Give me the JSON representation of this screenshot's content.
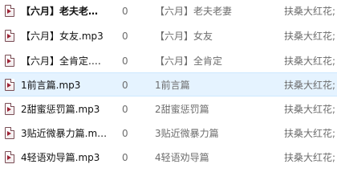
{
  "rows": [
    {
      "name": "【六月】老夫老妻....",
      "number": "0",
      "title": "【六月】老夫老妻",
      "artist": "扶桑大红花;"
    },
    {
      "name": "【六月】女友.mp3",
      "number": "0",
      "title": "【六月】女友",
      "artist": "扶桑大红花;"
    },
    {
      "name": "【六月】全肯定.mp3",
      "number": "0",
      "title": "【六月】全肯定",
      "artist": "扶桑大红花;"
    },
    {
      "name": "1前言篇.mp3",
      "number": "0",
      "title": "1前言篇",
      "artist": "扶桑大红花;"
    },
    {
      "name": "2甜蜜惩罚篇.mp3",
      "number": "0",
      "title": "2甜蜜惩罚篇",
      "artist": "扶桑大红花;"
    },
    {
      "name": "3贴近微暴力篇.mp3",
      "number": "0",
      "title": "3贴近微暴力篇",
      "artist": "扶桑大红花;"
    },
    {
      "name": "4轻语劝导篇.mp3",
      "number": "0",
      "title": "4轻语劝导篇",
      "artist": "扶桑大红花;"
    }
  ],
  "icon": "audio-file-icon",
  "colors": {
    "selected_background": "#e5f3ff",
    "selected_border": "#cde8ff",
    "secondary_text": "#6d6d6d"
  }
}
